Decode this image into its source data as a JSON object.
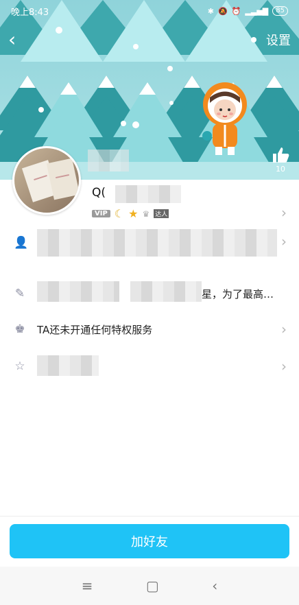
{
  "status": {
    "time": "晚上8:43",
    "battery": "85"
  },
  "nav": {
    "back_icon": "back-chevron-icon",
    "settings_label": "设置"
  },
  "like": {
    "count": "10"
  },
  "profile": {
    "name_visible": "Q(",
    "vip_badge": "VIP",
    "level_tag": "达人"
  },
  "rows": {
    "signature_suffix": "星，为了最高…",
    "privilege": "TA还未开通任何特权服务"
  },
  "actions": {
    "add_friend": "加好友"
  },
  "colors": {
    "accent": "#1fc3f6",
    "banner": "#9fdbe0",
    "tree": "#2f8f96"
  }
}
